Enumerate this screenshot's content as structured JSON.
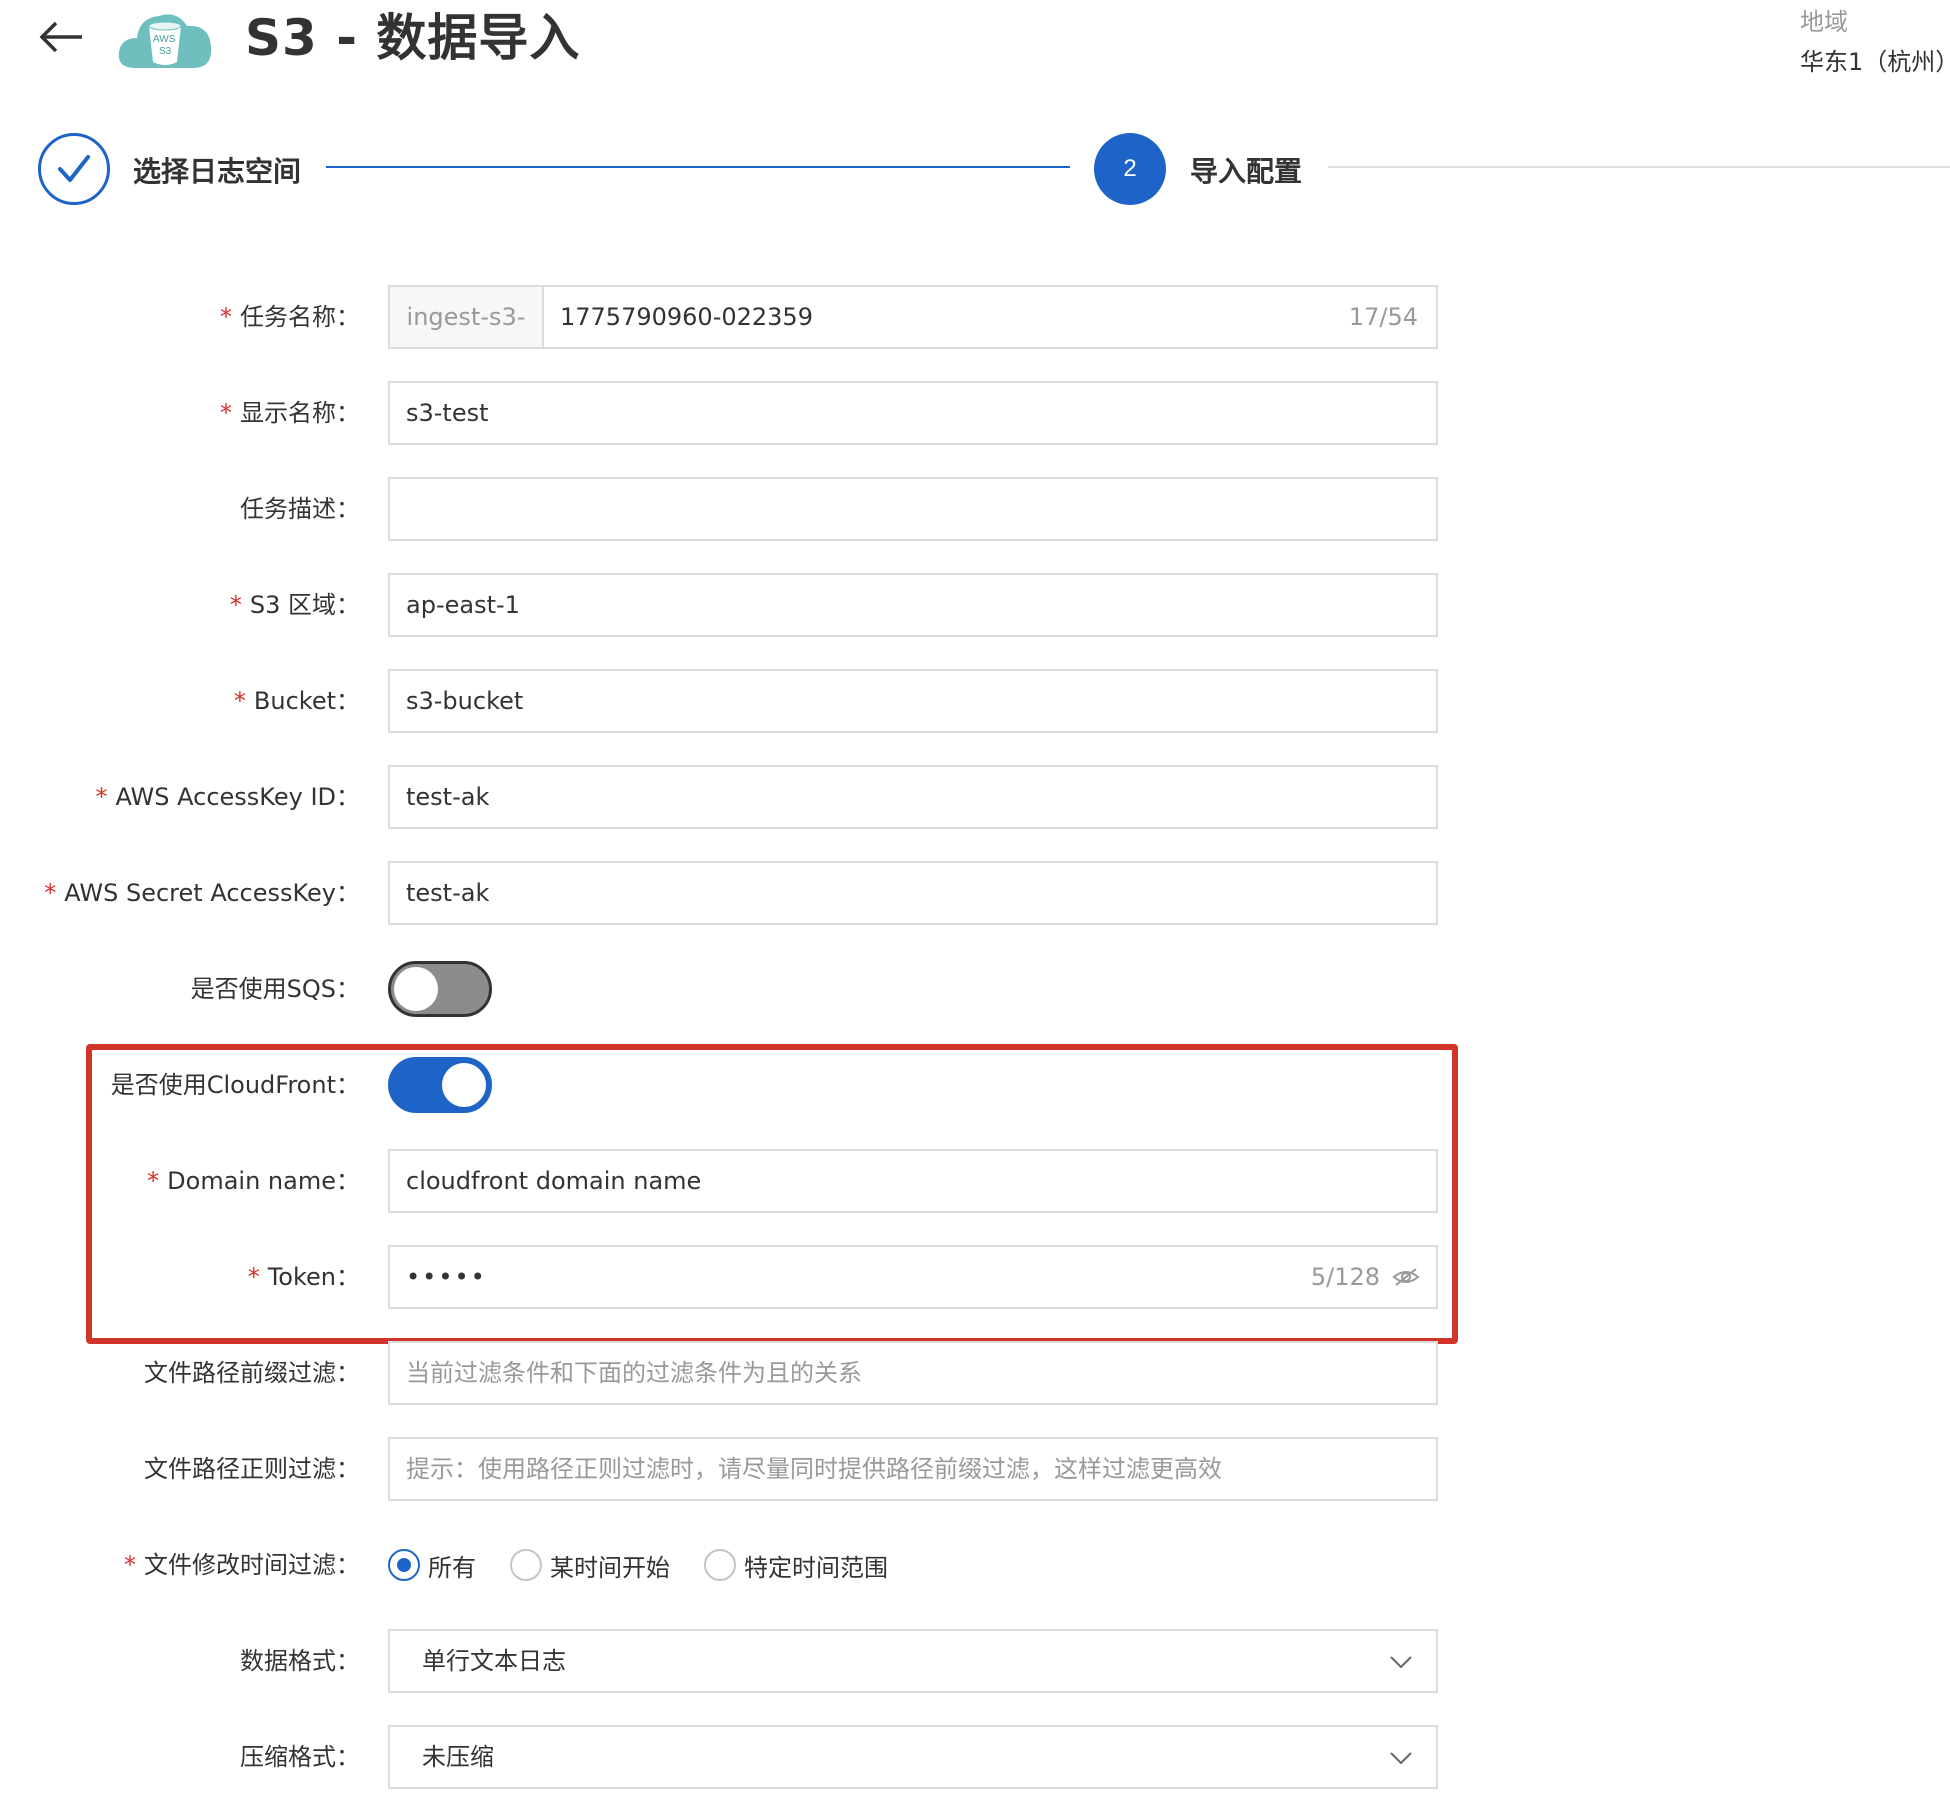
{
  "header": {
    "title": "S3 - 数据导入",
    "logo_text_top": "AWS",
    "logo_text_bottom": "S3",
    "region_label": "地域",
    "region_value": "华东1（杭州）"
  },
  "steps": [
    {
      "label": "选择日志空间",
      "state": "done"
    },
    {
      "number": "2",
      "label": "导入配置",
      "state": "active"
    }
  ],
  "form": {
    "task_name": {
      "label": "任务名称：",
      "required": true,
      "prefix": "ingest-s3-",
      "value": "1775790960-022359",
      "count": "17/54"
    },
    "display_name": {
      "label": "显示名称：",
      "required": true,
      "value": "s3-test"
    },
    "task_desc": {
      "label": "任务描述：",
      "required": false,
      "value": ""
    },
    "s3_region": {
      "label": "S3 区域：",
      "required": true,
      "value": "ap-east-1"
    },
    "bucket": {
      "label": "Bucket：",
      "required": true,
      "value": "s3-bucket"
    },
    "access_key_id": {
      "label": "AWS AccessKey ID：",
      "required": true,
      "value": "test-ak"
    },
    "secret_access_key": {
      "label": "AWS Secret AccessKey：",
      "required": true,
      "value": "test-ak"
    },
    "use_sqs": {
      "label": "是否使用SQS：",
      "enabled": false
    },
    "use_cloudfront": {
      "label": "是否使用CloudFront：",
      "enabled": true
    },
    "domain_name": {
      "label": "Domain name：",
      "required": true,
      "value": "cloudfront domain name"
    },
    "token": {
      "label": "Token：",
      "required": true,
      "value": "•••••",
      "count": "5/128"
    },
    "path_prefix_filter": {
      "label": "文件路径前缀过滤：",
      "placeholder": "当前过滤条件和下面的过滤条件为且的关系"
    },
    "path_regex_filter": {
      "label": "文件路径正则过滤：",
      "placeholder": "提示：使用路径正则过滤时，请尽量同时提供路径前缀过滤，这样过滤更高效"
    },
    "mtime_filter": {
      "label": "文件修改时间过滤：",
      "required": true,
      "options": [
        "所有",
        "某时间开始",
        "特定时间范围"
      ],
      "selected": "所有"
    },
    "data_format": {
      "label": "数据格式：",
      "value": "单行文本日志"
    },
    "compress_format": {
      "label": "压缩格式：",
      "value": "未压缩"
    }
  },
  "colors": {
    "accent": "#1e64c8",
    "required": "#d93026",
    "highlight": "#d1342a"
  }
}
